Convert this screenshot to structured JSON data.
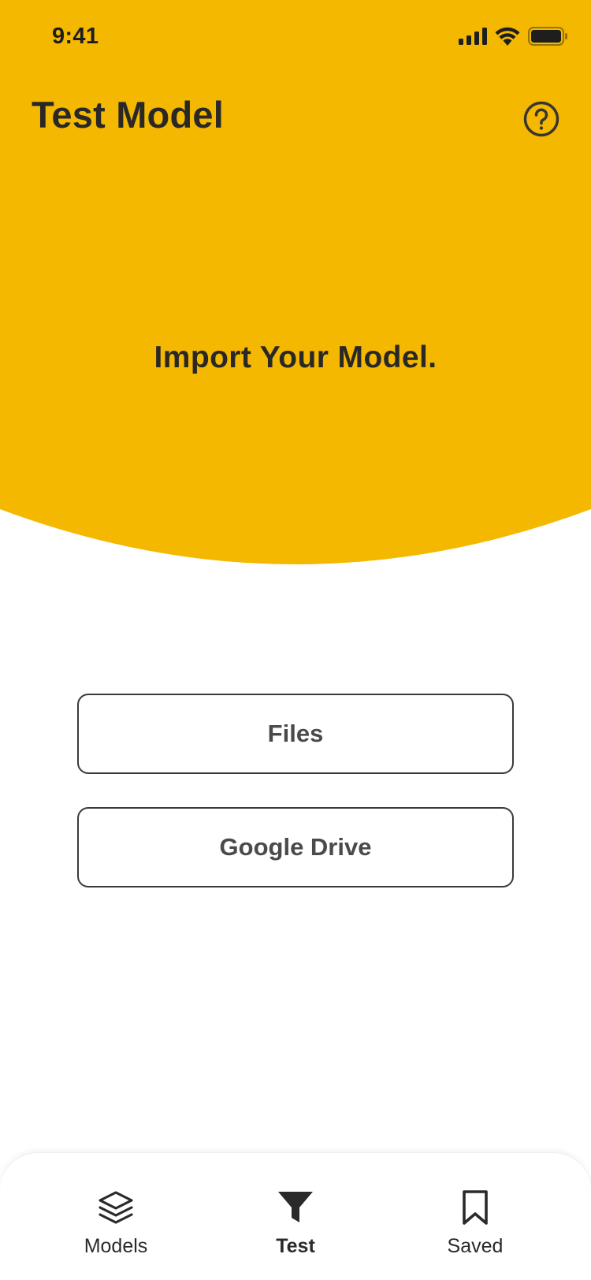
{
  "status_bar": {
    "time": "9:41",
    "icons": [
      "signal-icon",
      "wifi-icon",
      "battery-icon"
    ]
  },
  "header": {
    "title": "Test Model",
    "help_icon": "help-circle-icon"
  },
  "hero": {
    "message": "Import Your Model."
  },
  "import_options": {
    "files_label": "Files",
    "drive_label": "Google Drive"
  },
  "tab_bar": {
    "items": [
      {
        "label": "Models",
        "icon": "layers-icon",
        "active": false
      },
      {
        "label": "Test",
        "icon": "filter-icon",
        "active": true
      },
      {
        "label": "Saved",
        "icon": "bookmark-icon",
        "active": false
      }
    ]
  },
  "colors": {
    "accent": "#F4B800",
    "text_dark": "#2A2826",
    "button_border": "#3A3A3A",
    "button_text": "#4A4A4A"
  }
}
